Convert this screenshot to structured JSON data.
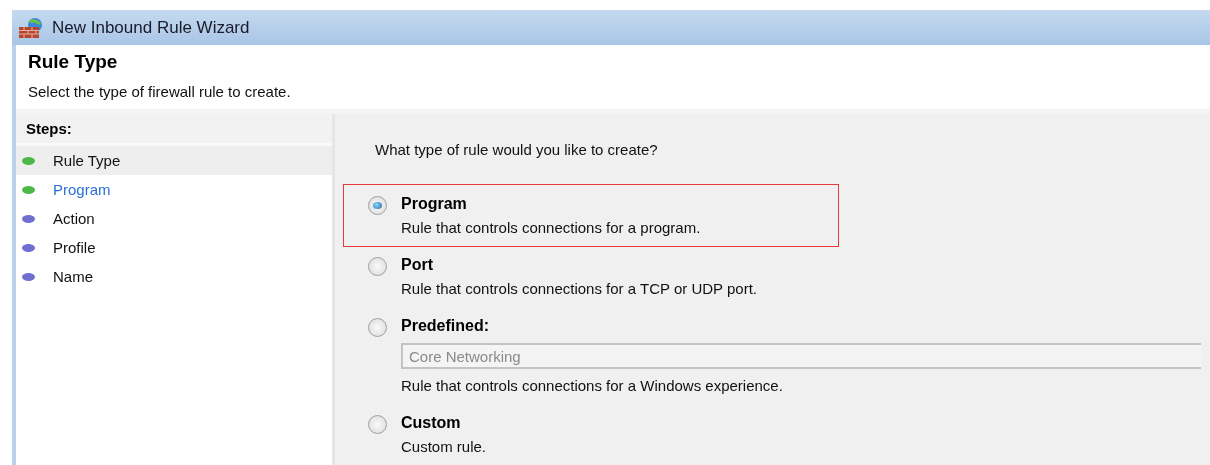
{
  "window": {
    "title": "New Inbound Rule Wizard"
  },
  "header": {
    "title": "Rule Type",
    "subtitle": "Select the type of firewall rule to create."
  },
  "steps": {
    "heading": "Steps:",
    "items": [
      {
        "label": "Rule Type",
        "color": "#4cb848",
        "selected": true,
        "hovered": false
      },
      {
        "label": "Program",
        "color": "#4cb848",
        "selected": false,
        "hovered": true
      },
      {
        "label": "Action",
        "color": "#6f6fd0",
        "selected": false,
        "hovered": false
      },
      {
        "label": "Profile",
        "color": "#6f6fd0",
        "selected": false,
        "hovered": false
      },
      {
        "label": "Name",
        "color": "#6f6fd0",
        "selected": false,
        "hovered": false
      }
    ]
  },
  "question": "What type of rule would you like to create?",
  "options": [
    {
      "label": "Program",
      "description": "Rule that controls connections for a program.",
      "selected": true,
      "highlighted": true
    },
    {
      "label": "Port",
      "description": "Rule that controls connections for a TCP or UDP port.",
      "selected": false,
      "highlighted": false
    },
    {
      "label": "Predefined:",
      "dropdown": {
        "value": "Core Networking",
        "disabled": true
      },
      "description": "Rule that controls connections for a Windows experience.",
      "selected": false,
      "highlighted": false
    },
    {
      "label": "Custom",
      "description": "Custom rule.",
      "selected": false,
      "highlighted": false
    }
  ]
}
